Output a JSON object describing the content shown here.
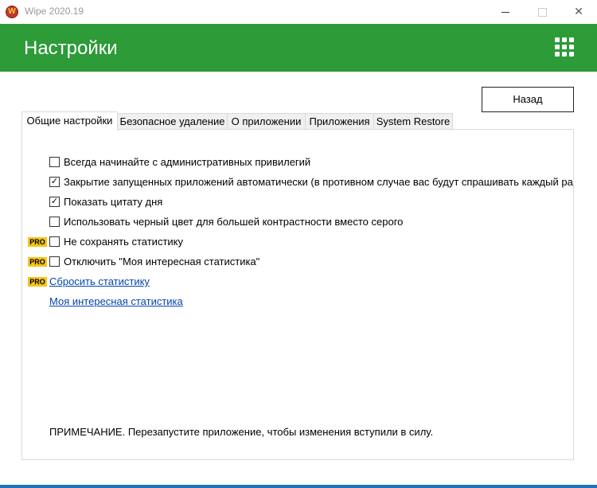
{
  "window": {
    "title": "Wipe 2020.19",
    "logo_letter": "W",
    "close_glyph": "✕"
  },
  "header": {
    "title": "Настройки"
  },
  "back_button": {
    "label": "Назад"
  },
  "tabs": [
    {
      "label": "Общие настройки",
      "active": true
    },
    {
      "label": "Безопасное удаление"
    },
    {
      "label": "О приложении"
    },
    {
      "label": "Приложения"
    },
    {
      "label": "System Restore"
    }
  ],
  "settings": {
    "pro_badge": "PRO",
    "check_glyph": "✓",
    "items": [
      {
        "label": "Всегда начинайте с административных привилегий",
        "checked": false,
        "pro": false
      },
      {
        "label": "Закрытие запущенных приложений автоматически (в противном случае вас будут спрашивать каждый раз)",
        "checked": true,
        "pro": false
      },
      {
        "label": "Показать цитату дня",
        "checked": true,
        "pro": false
      },
      {
        "label": "Использовать черный цвет для большей контрастности вместо серого",
        "checked": false,
        "pro": false
      },
      {
        "label": "Не сохранять статистику",
        "checked": false,
        "pro": true
      },
      {
        "label": "Отключить \"Моя интересная статистика\"",
        "checked": false,
        "pro": true
      }
    ],
    "links": [
      {
        "label": "Сбросить статистику",
        "pro": true
      },
      {
        "label": "Моя интересная статистика",
        "pro": false
      }
    ],
    "note": "ПРИМЕЧАНИЕ. Перезапустите приложение, чтобы изменения вступили в силу."
  },
  "colors": {
    "header_green": "#2c9b38",
    "pro_yellow": "#f5c518",
    "link_blue": "#0645ad",
    "accent_blue": "#1e73be"
  }
}
